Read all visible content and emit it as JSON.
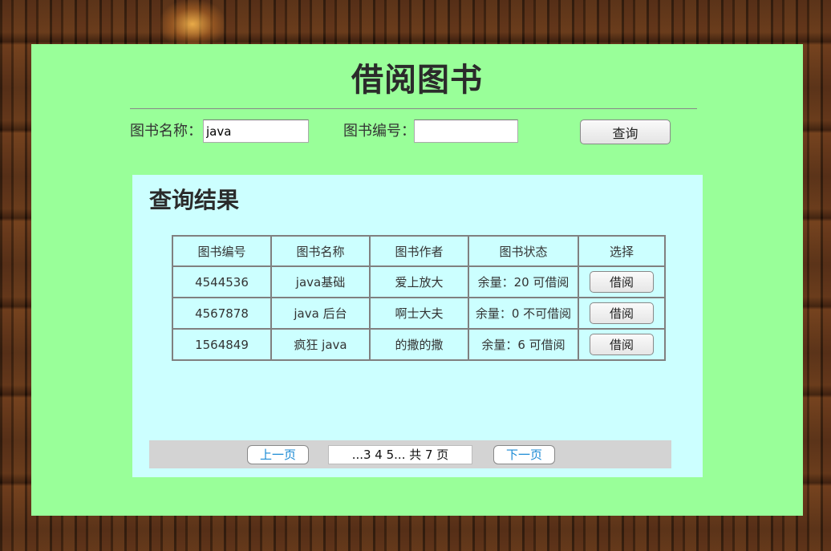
{
  "page": {
    "title": "借阅图书"
  },
  "search": {
    "name_label": "图书名称：",
    "name_value": "java",
    "id_label": "图书编号：",
    "id_value": "",
    "button_label": "查询"
  },
  "results": {
    "title": "查询结果",
    "headers": [
      "图书编号",
      "图书名称",
      "图书作者",
      "图书状态",
      "选择"
    ],
    "rows": [
      {
        "id": "4544536",
        "name": "java基础",
        "author": "爱上放大",
        "status": "余量：20  可借阅",
        "action": "借阅"
      },
      {
        "id": "4567878",
        "name": "java 后台",
        "author": "啊士大夫",
        "status": "余量：0  不可借阅",
        "action": "借阅"
      },
      {
        "id": "1564849",
        "name": "疯狂 java",
        "author": "的撒的撒",
        "status": "余量：6  可借阅",
        "action": "借阅"
      }
    ]
  },
  "pager": {
    "prev_label": "上一页",
    "info": "...3 4 5...  共 7  页",
    "next_label": "下一页",
    "link_color": "#1a8ad4"
  },
  "colors": {
    "panel": "#99ff99",
    "results_bg": "#ccffff",
    "pager_bg": "#d3d3d3"
  }
}
